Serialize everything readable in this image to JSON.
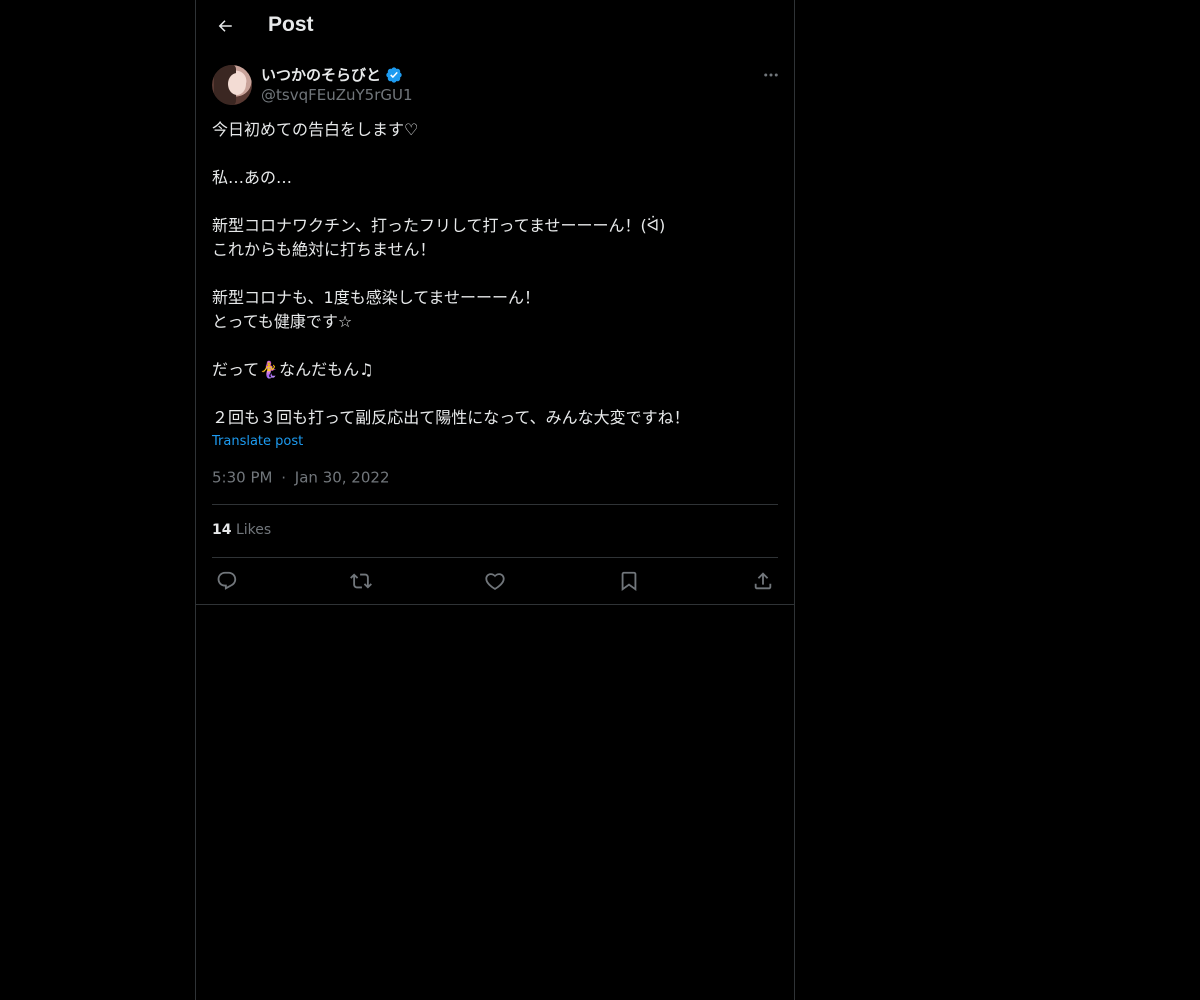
{
  "header": {
    "title": "Post",
    "back_icon": "arrow-left-icon"
  },
  "author": {
    "display_name": "いつかのそらびと",
    "handle": "@tsvqFEuZuY5rGU1",
    "verified": true,
    "verified_color": "#1d9bf0"
  },
  "post": {
    "lines": [
      "今日初めての告白をします♡",
      "",
      "私…あの…",
      "",
      "新型コロナワクチン、打ったフリして打ってませーーーん！(ᐛ)",
      "これからも絶対に打ちません！",
      "",
      "新型コロナも、1度も感染してませーーーん！",
      "とっても健康です☆",
      "",
      "だって🧜‍♀️なんだもん♫",
      "",
      "２回も３回も打って副反応出て陽性になって、みんな大変ですね！"
    ],
    "translate_label": "Translate post",
    "time": "5:30 PM",
    "separator": "·",
    "date": "Jan 30, 2022"
  },
  "stats": {
    "likes_count": "14",
    "likes_label": "Likes"
  },
  "actions": {
    "reply_icon": "reply-icon",
    "repost_icon": "repost-icon",
    "like_icon": "heart-icon",
    "bookmark_icon": "bookmark-icon",
    "share_icon": "share-icon"
  },
  "colors": {
    "background": "#000000",
    "text": "#e7e9ea",
    "secondary_text": "#71767b",
    "border": "#2f3336",
    "accent": "#1d9bf0"
  }
}
